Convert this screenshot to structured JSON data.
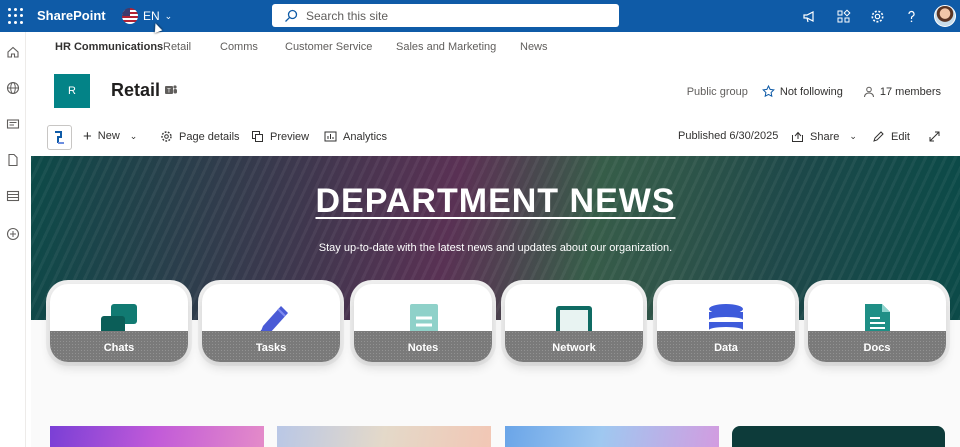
{
  "suite": {
    "app_name": "SharePoint",
    "language": "EN",
    "search_placeholder": "Search this site"
  },
  "hub": {
    "title": "HR Communications",
    "links": [
      "Retail",
      "Comms",
      "Customer Service",
      "Sales and Marketing",
      "News"
    ]
  },
  "site": {
    "logo_letter": "R",
    "title": "Retail",
    "group_type": "Public group",
    "follow_label": "Not following",
    "members_label": "17 members"
  },
  "commands": {
    "new_label": "New",
    "page_details_label": "Page details",
    "preview_label": "Preview",
    "analytics_label": "Analytics",
    "published_label": "Published 6/30/2025",
    "share_label": "Share",
    "edit_label": "Edit"
  },
  "hero": {
    "title": "DEPARTMENT NEWS",
    "subtitle": "Stay up-to-date with the latest news and updates about our organization."
  },
  "tiles": [
    {
      "label": "Chats",
      "icon": "chat-icon",
      "color": "#117a72"
    },
    {
      "label": "Tasks",
      "icon": "pencil-icon",
      "color": "#4a5bd6"
    },
    {
      "label": "Notes",
      "icon": "notes-icon",
      "color": "#8fd1c9"
    },
    {
      "label": "Network",
      "icon": "tablet-icon",
      "color": "#0f6b63"
    },
    {
      "label": "Data",
      "icon": "database-icon",
      "color": "#3e5bdb"
    },
    {
      "label": "Docs",
      "icon": "document-icon",
      "color": "#1f8f86"
    }
  ],
  "colors": {
    "suite_bar": "#0f5ba7",
    "site_logo": "#038387",
    "accent": "#0f5ba7"
  }
}
